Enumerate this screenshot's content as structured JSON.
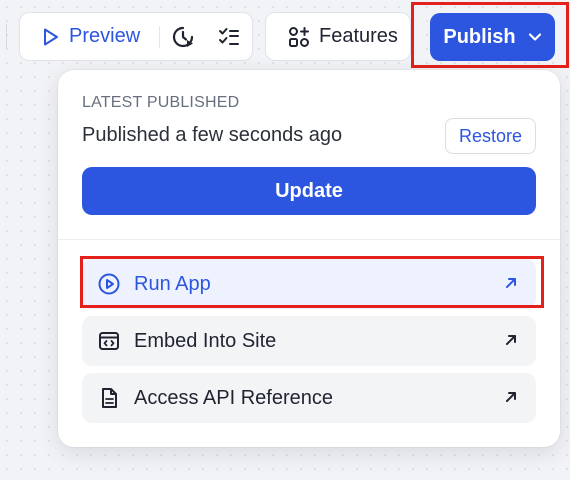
{
  "toolbar": {
    "preview_label": "Preview",
    "features_label": "Features",
    "publish_label": "Publish"
  },
  "panel": {
    "latest_label": "LATEST PUBLISHED",
    "published_time": "Published a few seconds ago",
    "restore_label": "Restore",
    "update_label": "Update",
    "menu_items": [
      {
        "label": "Run App",
        "icon": "play-circle-icon",
        "active": true
      },
      {
        "label": "Embed Into Site",
        "icon": "embed-icon",
        "active": false
      },
      {
        "label": "Access API Reference",
        "icon": "document-icon",
        "active": false
      }
    ]
  },
  "colors": {
    "accent": "#2c55e0",
    "highlight": "#e3201b"
  }
}
